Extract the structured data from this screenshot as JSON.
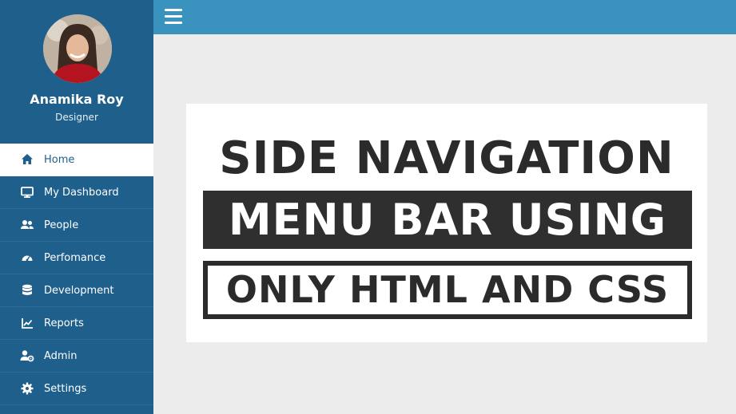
{
  "profile": {
    "name": "Anamika Roy",
    "role": "Designer"
  },
  "sidebar": {
    "items": [
      {
        "label": "Home",
        "icon": "home-icon",
        "active": true
      },
      {
        "label": "My Dashboard",
        "icon": "monitor-icon",
        "active": false
      },
      {
        "label": "People",
        "icon": "users-icon",
        "active": false
      },
      {
        "label": "Perfomance",
        "icon": "gauge-icon",
        "active": false
      },
      {
        "label": "Development",
        "icon": "database-icon",
        "active": false
      },
      {
        "label": "Reports",
        "icon": "line-chart-icon",
        "active": false
      },
      {
        "label": "Admin",
        "icon": "user-cog-icon",
        "active": false
      },
      {
        "label": "Settings",
        "icon": "gear-icon",
        "active": false
      }
    ]
  },
  "topbar": {
    "menu_icon": "hamburger-icon"
  },
  "banner": {
    "line1": "SIDE NAVIGATION",
    "line2": "MENU BAR USING",
    "line3": "ONLY HTML AND CSS"
  },
  "colors": {
    "sidebar": "#1f5f8b",
    "topbar": "#3a93bf",
    "content_bg": "#ececec",
    "banner_text": "#2b2b2b"
  }
}
